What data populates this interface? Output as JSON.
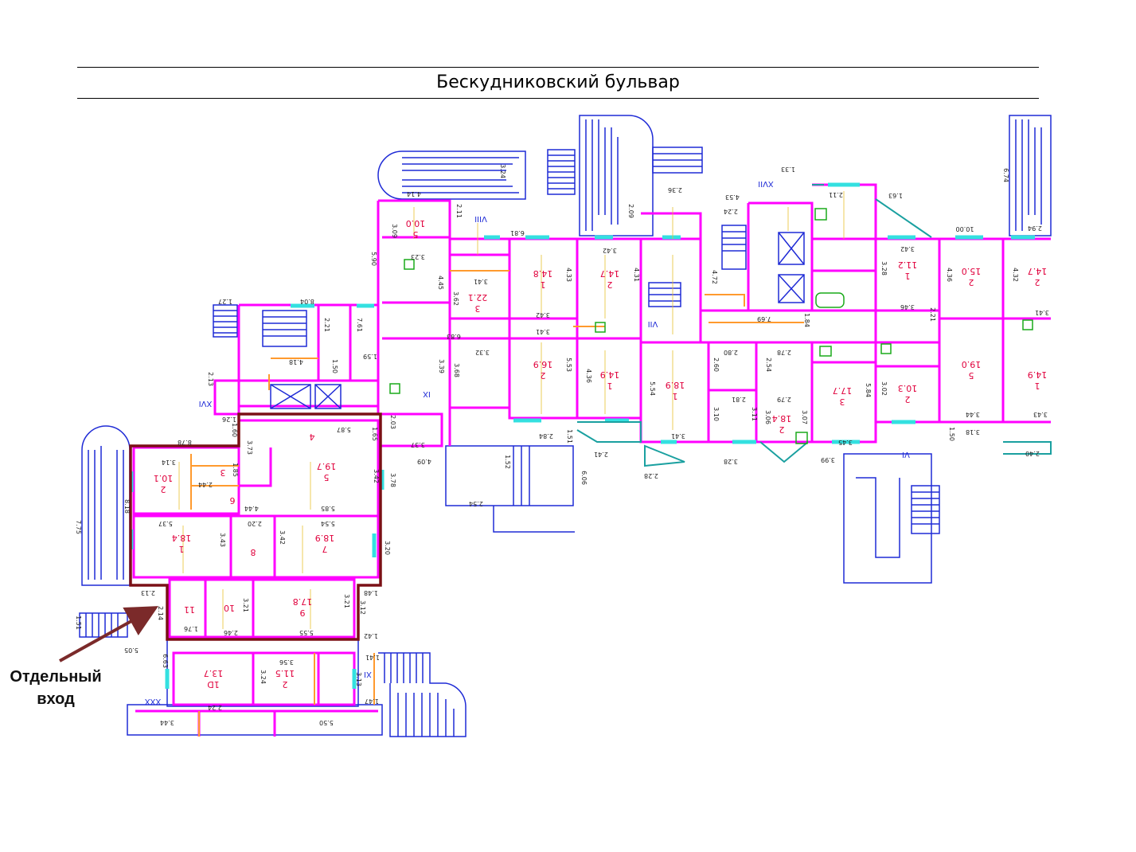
{
  "street": {
    "name": "Бескудниковский бульвар"
  },
  "callout": {
    "line1": "Отдельный",
    "line2": "вход"
  },
  "colors": {
    "wall": "#ff00ff",
    "outline": "#1f2bd6",
    "window": "#33e0e0",
    "fixture": "#ff9a2e",
    "highlight": "#7b1016",
    "arrow": "#7b2a2a",
    "dimension": "#222222",
    "room_label": "#e0003c"
  },
  "highlighted_unit": {
    "rooms": [
      {
        "id": "2",
        "area": "10.1"
      },
      {
        "id": "3",
        "area": ""
      },
      {
        "id": "4",
        "area": ""
      },
      {
        "id": "5",
        "area": "19.7"
      },
      {
        "id": "6",
        "area": ""
      },
      {
        "id": "1",
        "area": "18.4"
      },
      {
        "id": "8",
        "area": ""
      },
      {
        "id": "7",
        "area": "18.9"
      },
      {
        "id": "11",
        "area": ""
      },
      {
        "id": "10",
        "area": ""
      },
      {
        "id": "9",
        "area": "17.8"
      }
    ],
    "dimensions": [
      "3.14",
      "5.37",
      "3.43",
      "2.20",
      "3.42",
      "5.54",
      "5.85",
      "4.44",
      "3.73",
      "5.87",
      "1.65",
      "3.42",
      "3.78",
      "3.20",
      "2.13",
      "1.76",
      "2.46",
      "3.21",
      "5.55",
      "3.21",
      "3.12",
      "1.48",
      "1.42",
      "8.78",
      "8.18",
      "2.14",
      "5.05",
      "7.75",
      "1.51",
      "2.44",
      "1.85"
    ]
  },
  "room_labels": [
    {
      "id": "5",
      "area": "10.0"
    },
    {
      "id": "3",
      "area": "22.1"
    },
    {
      "id": "1",
      "area": "14.8"
    },
    {
      "id": "2",
      "area": "14.7"
    },
    {
      "id": "2",
      "area": "16.9"
    },
    {
      "id": "1",
      "area": "14.9"
    },
    {
      "id": "1",
      "area": "18.9"
    },
    {
      "id": "2",
      "area": "18.4"
    },
    {
      "id": "3",
      "area": "17.7"
    },
    {
      "id": "1",
      "area": "11.2"
    },
    {
      "id": "2",
      "area": "15.0"
    },
    {
      "id": "2",
      "area": "14.7"
    },
    {
      "id": "2",
      "area": "10.3"
    },
    {
      "id": "5",
      "area": "19.0"
    },
    {
      "id": "1",
      "area": "14.9"
    },
    {
      "id": "1D",
      "area": "13.7"
    },
    {
      "id": "2",
      "area": "11.5"
    }
  ],
  "roman_labels": [
    "VIII",
    "XVII",
    "VII",
    "IX",
    "XVI",
    "VI",
    "XI",
    "XXX"
  ],
  "dimension_labels": [
    "4.14",
    "3.24",
    "3.09",
    "2.11",
    "6.81",
    "3.23",
    "4.45",
    "3.41",
    "3.62",
    "5.90",
    "1.27",
    "8.04",
    "2.21",
    "7.61",
    "4.18",
    "1.59",
    "1.50",
    "6.83",
    "3.32",
    "3.39",
    "3.68",
    "2.13",
    "1.26",
    "1.60",
    "3.37",
    "4.09",
    "2.03",
    "1.33",
    "2.11",
    "1.63",
    "4.53",
    "2.24",
    "2.09",
    "2.36",
    "4.72",
    "3.42",
    "4.33",
    "4.31",
    "3.42",
    "3.41",
    "4.36",
    "5.53",
    "7.69",
    "1.84",
    "2.80",
    "2.78",
    "2.60",
    "2.54",
    "5.54",
    "3.41",
    "2.81",
    "3.10",
    "3.11",
    "3.06",
    "3.07",
    "2.79",
    "3.28",
    "3.99",
    "5.84",
    "3.45",
    "3.42",
    "3.28",
    "4.36",
    "4.32",
    "3.46",
    "3.41",
    "2.21",
    "3.02",
    "3.44",
    "3.18",
    "3.43",
    "1.50",
    "10.00",
    "6.74",
    "2.94",
    "2.84",
    "1.51",
    "1.52",
    "2.54",
    "2.41",
    "2.28",
    "6.06",
    "2.40",
    "6.63",
    "3.24",
    "3.56",
    "1.41",
    "3.13",
    "1.47",
    "2.24",
    "3.44",
    "5.50"
  ]
}
